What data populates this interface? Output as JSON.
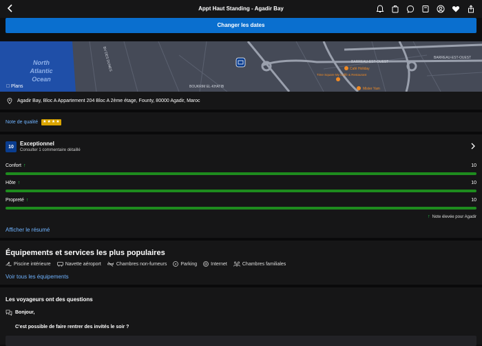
{
  "header": {
    "title": "Appt Haut Standing - Agadir Bay",
    "icons": [
      "chevron-left-icon",
      "bell-icon",
      "luggage-icon",
      "chat-icon",
      "book-icon",
      "profile-icon",
      "heart-icon",
      "share-icon"
    ]
  },
  "dates_button": "Changer les dates",
  "map": {
    "provider": "Plans",
    "ocean_label_1": "North",
    "ocean_label_2": "Atlantic",
    "ocean_label_3": "Ocean",
    "street_1": "BV DES DUNES",
    "street_2": "BARREAU-EST-OUEST",
    "street_3": "BARREAU-EST-OUEST",
    "street_4": "BOUKRIM EL-KHATIB",
    "poi_1": "Café Holiday",
    "poi_2": "Time Square My Caffé & Restaurant",
    "poi_3": "Mister Yam"
  },
  "address": "Agadir Bay, Bloc A Appartement 204 Bloc A 2ème étage, Founty, 80000 Agadir, Maroc",
  "quality": {
    "label": "Note de qualité",
    "stars": 4
  },
  "review": {
    "score": "10",
    "title": "Exceptionnel",
    "subtitle": "Consulter 1 commentaire détaillé",
    "ratings": [
      {
        "label": "Confort",
        "value": "10",
        "fraction": 1.0
      },
      {
        "label": "Hôte",
        "value": "10",
        "fraction": 1.0
      },
      {
        "label": "Propreté",
        "value": "10",
        "fraction": 1.0
      }
    ],
    "note_elevee": "Note élevée pour Agadir",
    "resume_link": "Afficher le résumé"
  },
  "equipements": {
    "title": "Équipements et services les plus populaires",
    "items": [
      {
        "icon": "pool-icon",
        "label": "Piscine intérieure"
      },
      {
        "icon": "shuttle-icon",
        "label": "Navette aéroport"
      },
      {
        "icon": "no-smoking-icon",
        "label": "Chambres non-fumeurs"
      },
      {
        "icon": "parking-icon",
        "label": "Parking"
      },
      {
        "icon": "wifi-icon",
        "label": "Internet"
      },
      {
        "icon": "family-icon",
        "label": "Chambres familiales"
      }
    ],
    "link": "Voir tous les équipements"
  },
  "qa": {
    "title": "Les voyageurs ont des questions",
    "greeting": "Bonjour,",
    "question": "C'est possible de faire rentrer des invités le soir ?"
  },
  "colors": {
    "accent": "#0a6fcf",
    "link": "#6fb3ff",
    "bar": "#1e8c1e",
    "background": "#0e0e0f",
    "panel": "#161617"
  }
}
